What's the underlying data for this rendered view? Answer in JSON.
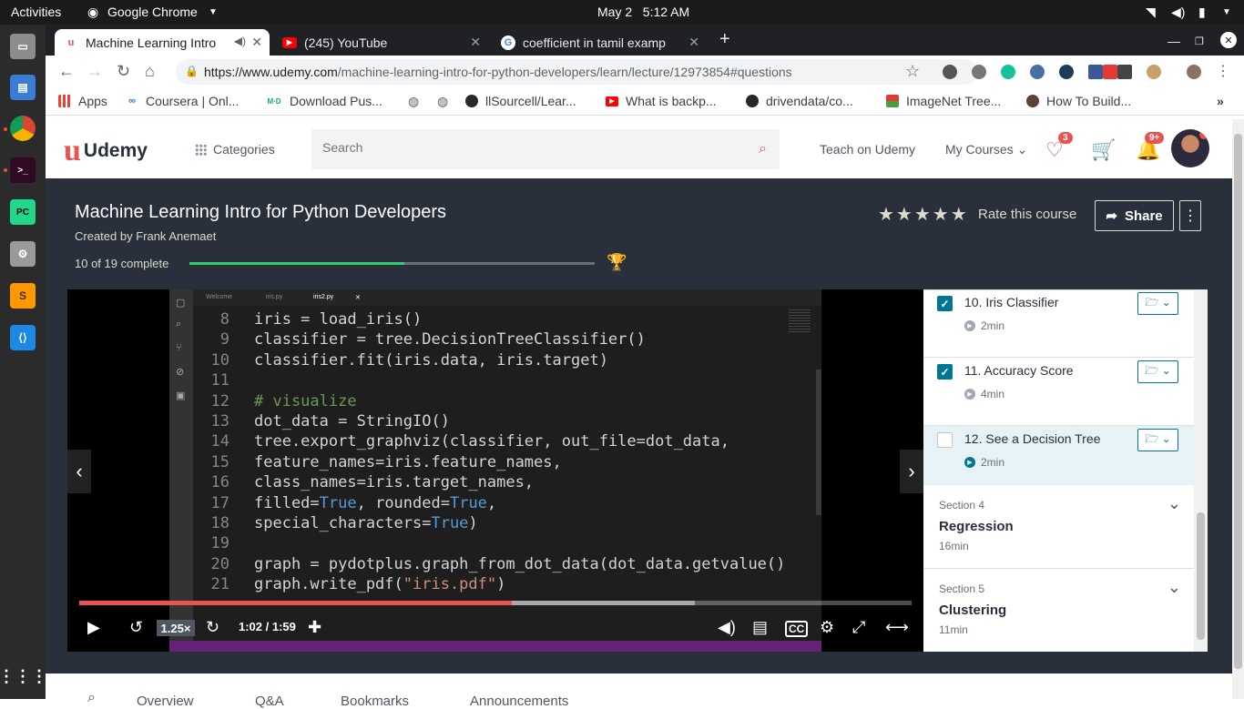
{
  "system": {
    "activities": "Activities",
    "app_name": "Google Chrome",
    "clock": "May 2   5:12 AM"
  },
  "browser": {
    "tabs": [
      {
        "label": "Machine Learning Intro",
        "active": true
      },
      {
        "label": "(245) YouTube",
        "active": false
      },
      {
        "label": "coefficient in tamil examp",
        "active": false
      }
    ],
    "url_domain": "https://www.udemy.com",
    "url_path": "/machine-learning-intro-for-python-developers/learn/lecture/12973854#questions",
    "bookmarks": [
      "Apps",
      "Coursera | Onl...",
      "Download Pus...",
      "llSourcell/Lear...",
      "What is backp...",
      "drivendata/co...",
      "ImageNet Tree...",
      "How To Build..."
    ]
  },
  "header": {
    "logo": "Udemy",
    "categories": "Categories",
    "search_placeholder": "Search",
    "teach": "Teach on Udemy",
    "my_courses": "My Courses",
    "wishlist_count": "3",
    "notifications_count": "9+"
  },
  "course": {
    "title": "Machine Learning Intro for Python Developers",
    "created_by": "Created by Frank Anemaet",
    "complete_text": "10 of 19 complete",
    "progress": 0.53,
    "rate": "Rate this course",
    "share": "Share"
  },
  "editor": {
    "tabs": [
      "Welcome",
      "iris.py",
      "iris2.py"
    ],
    "lines": [
      {
        "n": "8",
        "parts": [
          [
            "t",
            "iris = load_iris()"
          ]
        ]
      },
      {
        "n": "9",
        "parts": [
          [
            "t",
            "classifier = tree.DecisionTreeClassifier()"
          ]
        ]
      },
      {
        "n": "10",
        "parts": [
          [
            "t",
            "classifier.fit(iris.data, iris.target)"
          ]
        ]
      },
      {
        "n": "11",
        "parts": []
      },
      {
        "n": "12",
        "parts": [
          [
            "cm",
            "# visualize"
          ]
        ]
      },
      {
        "n": "13",
        "parts": [
          [
            "t",
            "dot_data = StringIO()"
          ]
        ]
      },
      {
        "n": "14",
        "parts": [
          [
            "t",
            "tree.export_graphviz(classifier, out_file=dot_data,"
          ]
        ]
      },
      {
        "n": "15",
        "parts": [
          [
            "t",
            "feature_names=iris.feature_names,"
          ]
        ]
      },
      {
        "n": "16",
        "parts": [
          [
            "t",
            "class_names=iris.target_names,"
          ]
        ]
      },
      {
        "n": "17",
        "parts": [
          [
            "t",
            "filled="
          ],
          [
            "kw",
            "True"
          ],
          [
            "t",
            ", rounded="
          ],
          [
            "kw",
            "True"
          ],
          [
            "t",
            ","
          ]
        ]
      },
      {
        "n": "18",
        "parts": [
          [
            "t",
            "special_characters="
          ],
          [
            "kw",
            "True"
          ],
          [
            "t",
            ")"
          ]
        ]
      },
      {
        "n": "19",
        "parts": []
      },
      {
        "n": "20",
        "parts": [
          [
            "t",
            "graph = pydotplus.graph_from_dot_data(dot_data.getvalue())"
          ]
        ]
      },
      {
        "n": "21",
        "parts": [
          [
            "t",
            "graph.write_pdf("
          ],
          [
            "st",
            "\"iris.pdf\""
          ],
          [
            "t",
            ")"
          ]
        ]
      }
    ]
  },
  "player": {
    "rate": "1.25×",
    "time": "1:02 / 1:59",
    "played_fraction": 0.52,
    "buffered_fraction": 0.74
  },
  "curriculum": {
    "lectures": [
      {
        "title": "10. Iris Classifier",
        "duration": "2min",
        "done": true,
        "current": false
      },
      {
        "title": "11. Accuracy Score",
        "duration": "4min",
        "done": true,
        "current": false
      },
      {
        "title": "12. See a Decision Tree",
        "duration": "2min",
        "done": false,
        "current": true
      }
    ],
    "sections": [
      {
        "number": "Section 4",
        "name": "Regression",
        "duration": "16min"
      },
      {
        "number": "Section 5",
        "name": "Clustering",
        "duration": "11min"
      }
    ]
  },
  "bottom_tabs": [
    "Overview",
    "Q&A",
    "Bookmarks",
    "Announcements"
  ]
}
